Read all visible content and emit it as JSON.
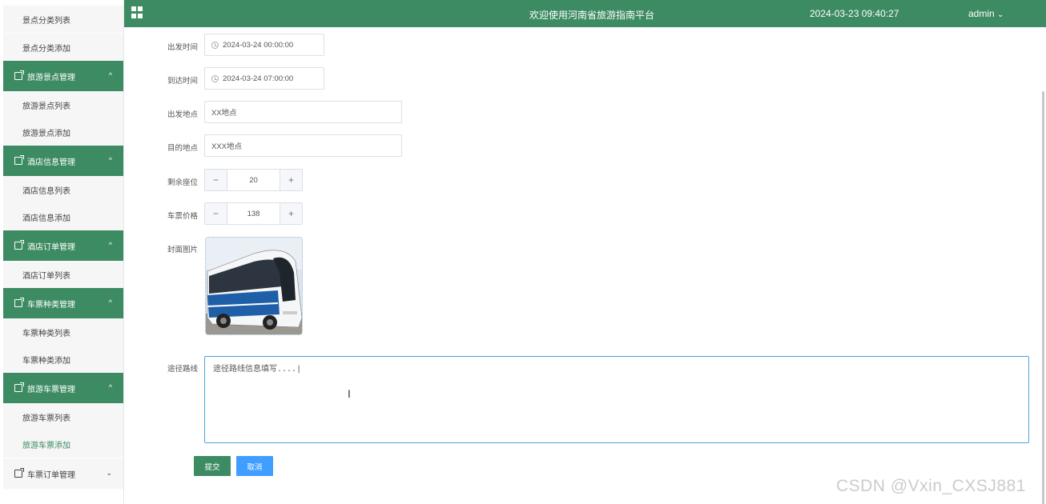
{
  "header": {
    "title": "欢迎使用河南省旅游指南平台",
    "datetime": "2024-03-23 09:40:27",
    "user": "admin",
    "user_caret": "⌄"
  },
  "sidebar": {
    "items": [
      {
        "label": "景点分类列表",
        "type": "item"
      },
      {
        "label": "景点分类添加",
        "type": "item"
      },
      {
        "label": "旅游景点管理",
        "type": "group",
        "arrow": "^"
      },
      {
        "label": "旅游景点列表",
        "type": "item"
      },
      {
        "label": "旅游景点添加",
        "type": "item"
      },
      {
        "label": "酒店信息管理",
        "type": "group",
        "arrow": "^"
      },
      {
        "label": "酒店信息列表",
        "type": "item"
      },
      {
        "label": "酒店信息添加",
        "type": "item"
      },
      {
        "label": "酒店订单管理",
        "type": "group",
        "arrow": "^"
      },
      {
        "label": "酒店订单列表",
        "type": "item"
      },
      {
        "label": "车票种类管理",
        "type": "group",
        "arrow": "^"
      },
      {
        "label": "车票种类列表",
        "type": "item"
      },
      {
        "label": "车票种类添加",
        "type": "item"
      },
      {
        "label": "旅游车票管理",
        "type": "group",
        "arrow": "^"
      },
      {
        "label": "旅游车票列表",
        "type": "item"
      },
      {
        "label": "旅游车票添加",
        "type": "item",
        "active": true
      },
      {
        "label": "车票订单管理",
        "type": "group-collapsed",
        "arrow": "⌄"
      }
    ]
  },
  "form": {
    "departure_time": {
      "label": "出发时间",
      "value": "2024-03-24 00:00:00"
    },
    "arrival_time": {
      "label": "到达时间",
      "value": "2024-03-24 07:00:00"
    },
    "departure_place": {
      "label": "出发地点",
      "value": "XX地点"
    },
    "destination": {
      "label": "目的地点",
      "value": "XXX地点"
    },
    "seats": {
      "label": "剩余座位",
      "value": "20",
      "minus": "−",
      "plus": "+"
    },
    "price": {
      "label": "车票价格",
      "value": "138",
      "minus": "−",
      "plus": "+"
    },
    "cover": {
      "label": "封面图片"
    },
    "route": {
      "label": "途径路线",
      "value": "途径路线信息填写....|"
    }
  },
  "buttons": {
    "submit": "提交",
    "cancel": "取消"
  },
  "watermark": "CSDN @Vxin_CXSJ881",
  "colors": {
    "primary": "#3d8b62",
    "cancel": "#409eff"
  }
}
